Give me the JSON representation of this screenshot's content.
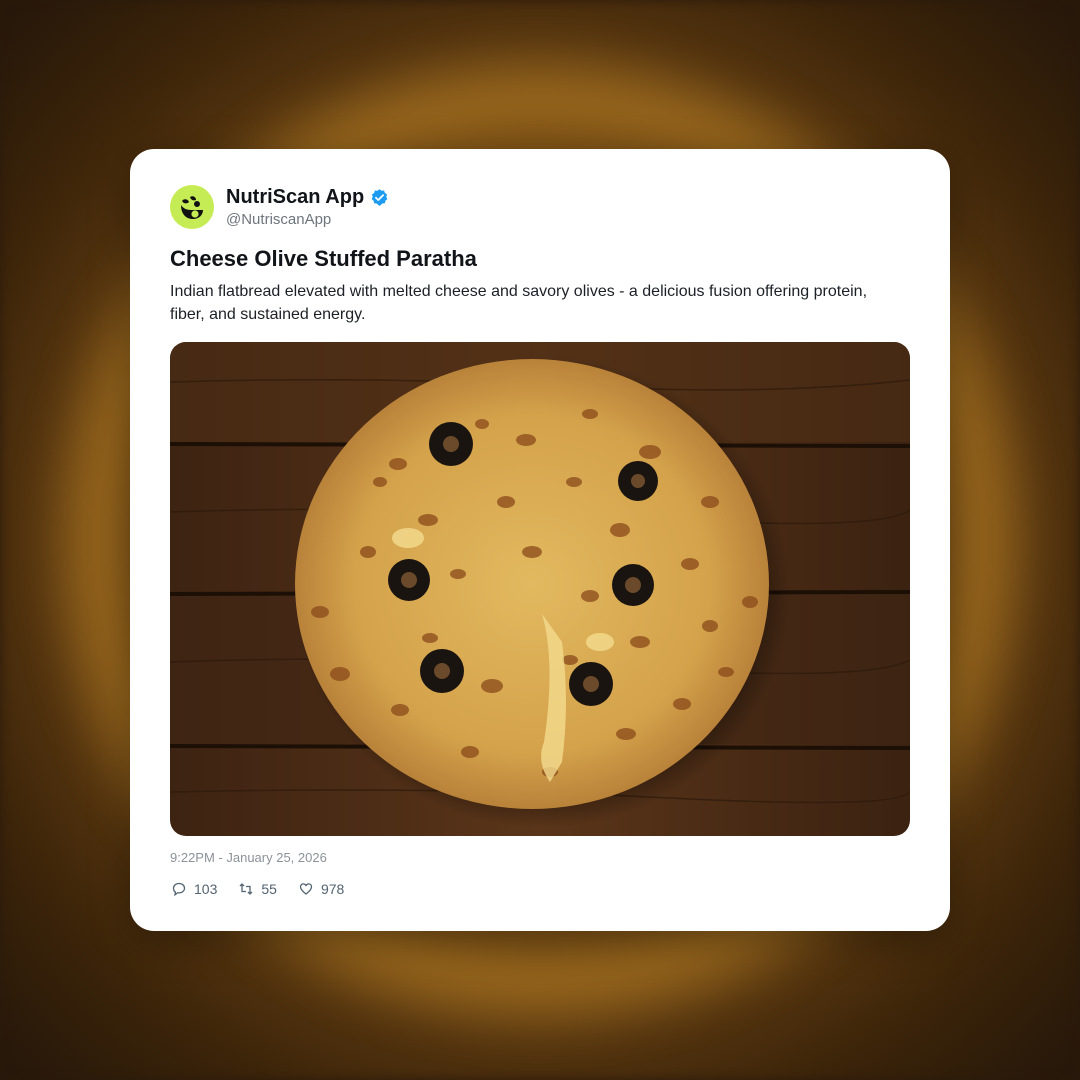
{
  "post": {
    "account_name": "NutriScan App",
    "handle": "@NutriscanApp",
    "verified": true,
    "title": "Cheese Olive Stuffed Paratha",
    "description": "Indian flatbread elevated with melted cheese and savory olives - a delicious fusion offering protein, fiber, and sustained energy.",
    "timestamp": "9:22PM - January 25, 2026",
    "stats": {
      "replies": "103",
      "reposts": "55",
      "likes": "978"
    },
    "icons": {
      "avatar": "nutriscan-logo-icon",
      "verified": "verified-badge-icon",
      "reply": "comment-bubble-icon",
      "repost": "repost-arrows-icon",
      "like": "heart-icon"
    },
    "colors": {
      "avatar_bg": "#c6ec55",
      "verified_blue": "#1d9bf0",
      "muted_text": "#6e767d"
    }
  }
}
